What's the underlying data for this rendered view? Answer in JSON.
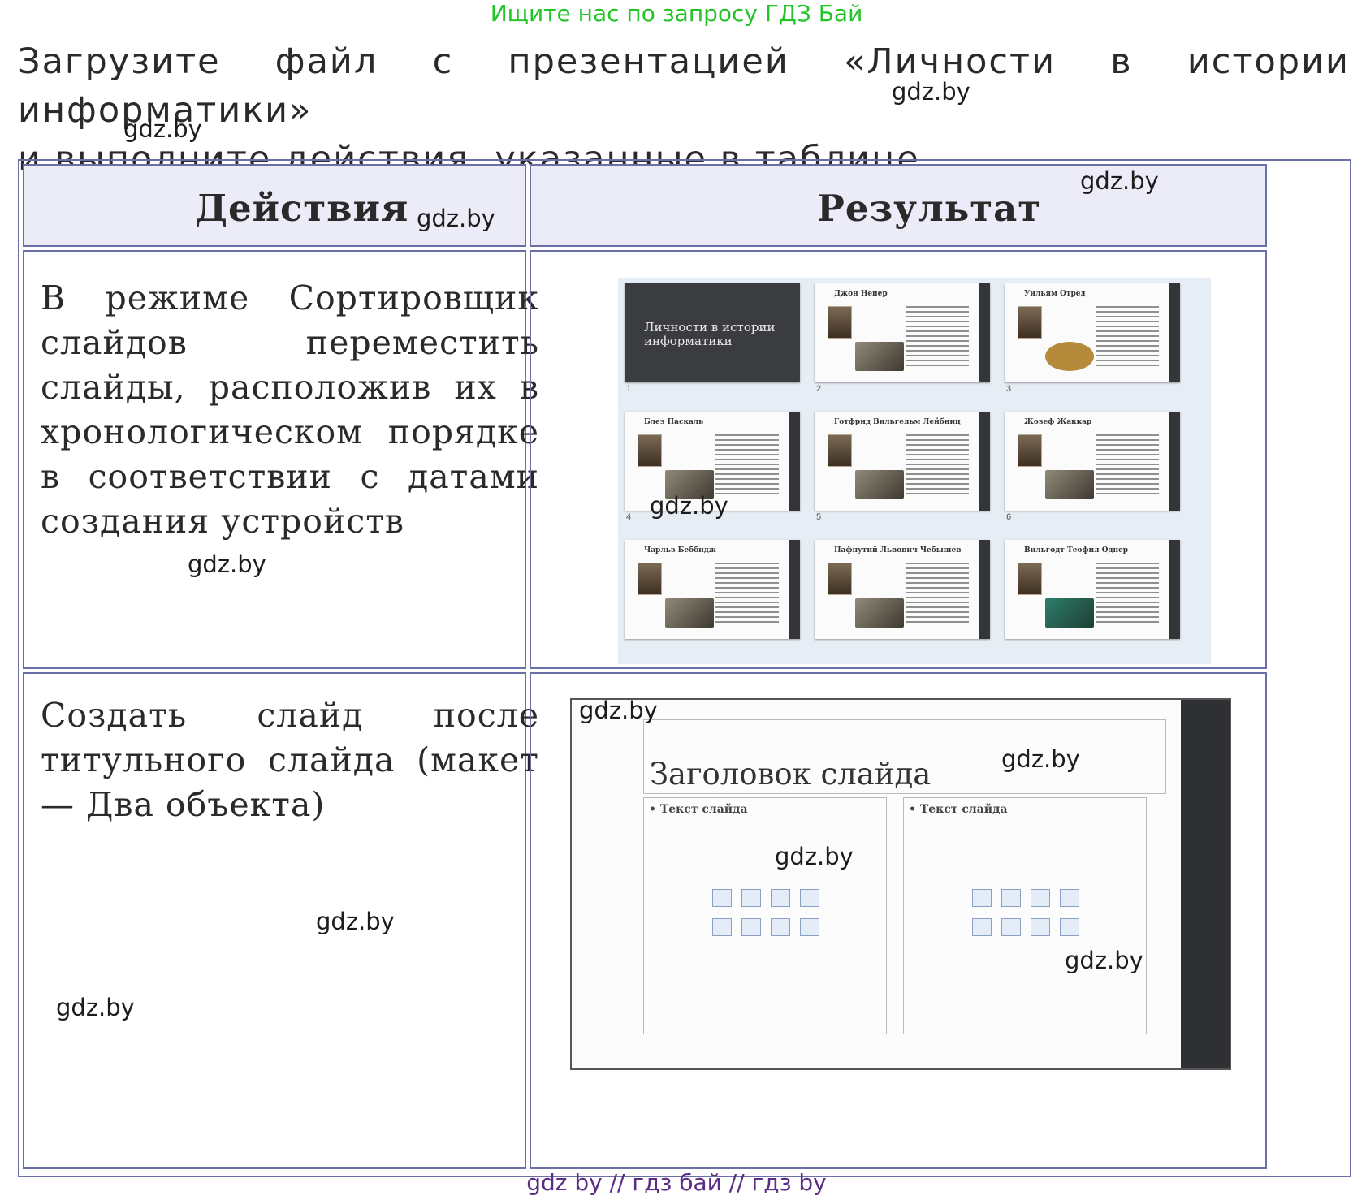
{
  "banner_top": "Ищите нас по запросу ГДЗ Бай",
  "intro": {
    "line1": "Загрузите файл с презентацией «Личности в истории информатики»",
    "line2": "и выполните действия, указанные в таблице."
  },
  "watermark": "gdz.by",
  "table": {
    "headers": {
      "actions": "Действия",
      "result": "Результат"
    },
    "rows": [
      {
        "action": "В режиме Сортировщик слайдов переместить слайды, расположив их в хронологическом порядке в соответствии с датами создания устройств"
      },
      {
        "action": "Создать слайд после титульного слайда (макет — Два объекта)"
      }
    ]
  },
  "sorter": {
    "title_slide_text": "Личности в истории информатики",
    "slides": [
      {
        "num": "1",
        "title": ""
      },
      {
        "num": "2",
        "title": "Джон Непер"
      },
      {
        "num": "3",
        "title": "Уильям Отред"
      },
      {
        "num": "4",
        "title": "Блез Паскаль"
      },
      {
        "num": "5",
        "title": "Готфрид Вильгельм Лейбниц"
      },
      {
        "num": "6",
        "title": "Жозеф Жаккар"
      },
      {
        "num": "",
        "title": "Чарльз Беббидж"
      },
      {
        "num": "",
        "title": "Пафнутий Львович Чебышев"
      },
      {
        "num": "",
        "title": "Вильгодт Теофил Однер"
      }
    ]
  },
  "layout_slide": {
    "title": "Заголовок слайда",
    "left_bullet": "• Текст слайда",
    "right_bullet": "• Текст слайда"
  },
  "banner_bottom": "gdz by  //  гдз бай  //  гдз by"
}
